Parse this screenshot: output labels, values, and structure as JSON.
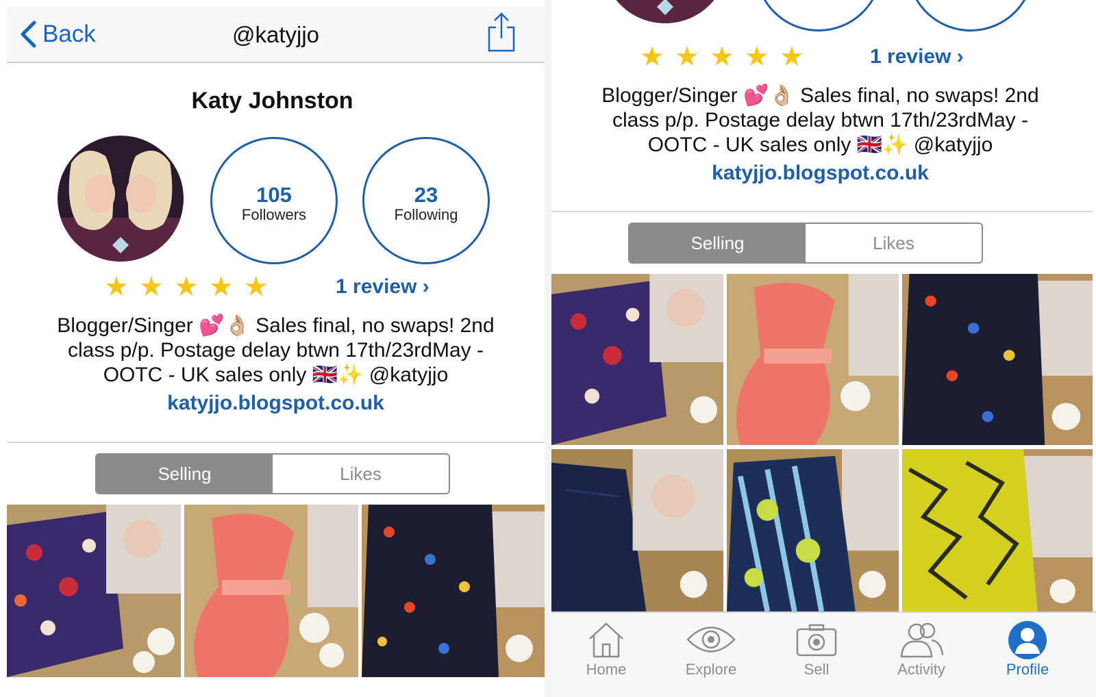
{
  "nav": {
    "back_label": "Back",
    "handle": "@katyjjo"
  },
  "profile": {
    "name": "Katy Johnston",
    "followers_count": "105",
    "followers_label": "Followers",
    "following_count": "23",
    "following_label": "Following",
    "rating_stars": 5,
    "stars_text": "★ ★ ★ ★ ★",
    "reviews_label": "1 review ›",
    "bio_line1": "Blogger/Singer 💕👌🏼 Sales final, no swaps! 2nd",
    "bio_line2": "class p/p. Postage delay btwn 17th/23rdMay -",
    "bio_line3": "OOTC - UK sales only 🇬🇧✨ @katyjjo",
    "website": "katyjjo.blogspot.co.uk"
  },
  "segments": {
    "selling": "Selling",
    "likes": "Likes",
    "selected": "Selling"
  },
  "listings": [
    {
      "name": "floral-shorts",
      "colors": [
        "#3a2a6b",
        "#c92d3c",
        "#f1e3d4"
      ]
    },
    {
      "name": "coral-bustier-dress",
      "colors": [
        "#ef7468",
        "#f4a093",
        "#d9cbb8"
      ]
    },
    {
      "name": "printed-playsuit",
      "colors": [
        "#1c1d2e",
        "#e8462b",
        "#3b6fd6"
      ]
    },
    {
      "name": "denim-skirt",
      "colors": [
        "#1a2446",
        "#2a3763",
        "#cdb392"
      ]
    },
    {
      "name": "tropical-dress",
      "colors": [
        "#1d2f59",
        "#c8dc46",
        "#8fc6e2"
      ]
    },
    {
      "name": "yellow-print-dress",
      "colors": [
        "#d5d01f",
        "#2b2b1d",
        "#e7e070"
      ]
    }
  ],
  "tabbar": [
    {
      "label": "Home",
      "icon": "home-icon",
      "active": false
    },
    {
      "label": "Explore",
      "icon": "eye-icon",
      "active": false
    },
    {
      "label": "Sell",
      "icon": "camera-icon",
      "active": false
    },
    {
      "label": "Activity",
      "icon": "people-icon",
      "active": false
    },
    {
      "label": "Profile",
      "icon": "profile-icon",
      "active": true
    }
  ],
  "colors": {
    "accent": "#1f5fa8",
    "star": "#f6c515",
    "segment_selected": "#8b8b8b",
    "tab_active": "#1f6fc6"
  }
}
